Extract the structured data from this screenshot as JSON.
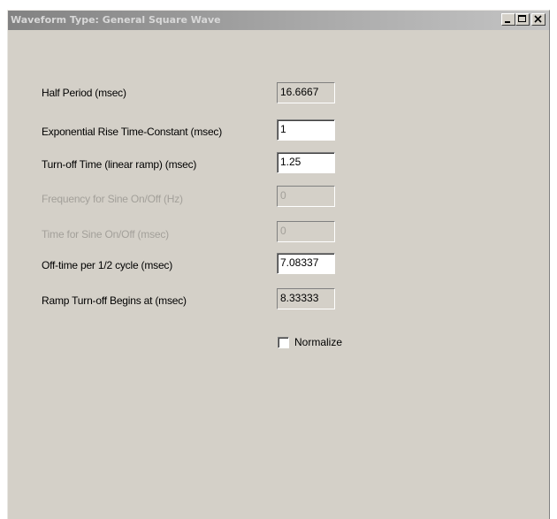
{
  "window": {
    "title": "Waveform Type:  General Square Wave",
    "buttons": {
      "minimize": "minimize-icon",
      "maximize": "maximize-icon",
      "close": "close-icon"
    }
  },
  "fields": [
    {
      "label": "Half Period (msec)",
      "value": "16.6667",
      "state": "readonly"
    },
    {
      "label": "Exponential Rise Time-Constant (msec)",
      "value": "1",
      "state": "editable"
    },
    {
      "label": "Turn-off Time (linear ramp) (msec)",
      "value": "1.25",
      "state": "editable"
    },
    {
      "label": "Frequency for Sine On/Off (Hz)",
      "value": "0",
      "state": "disabled"
    },
    {
      "label": "Time for Sine On/Off (msec)",
      "value": "0",
      "state": "disabled"
    },
    {
      "label": "Off-time per 1/2 cycle (msec)",
      "value": "7.08337",
      "state": "editable"
    },
    {
      "label": "Ramp Turn-off Begins at (msec)",
      "value": "8.33333",
      "state": "readonly"
    }
  ],
  "normalize": {
    "label": "Normalize",
    "checked": false
  },
  "colors": {
    "window_bg": "#d4d0c8",
    "title_gradient_start": "#828282",
    "disabled_text": "#a3a09a"
  }
}
